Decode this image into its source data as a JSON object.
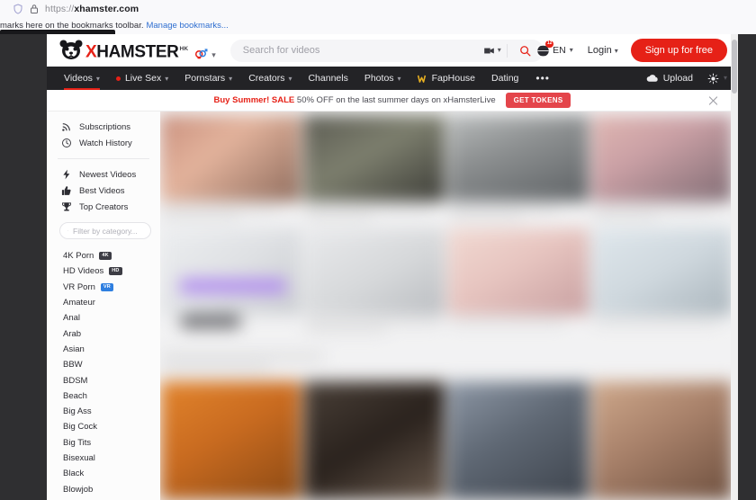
{
  "browser": {
    "url_prefix": "https://",
    "url_domain": "xhamster.com",
    "shield_icon": "shield-icon",
    "lock_icon": "lock-icon",
    "bookmark_text": "marks here on the bookmarks toolbar.",
    "bookmark_link": "Manage bookmarks..."
  },
  "site": {
    "logo": {
      "icon": "hamster-logo-icon",
      "x": "X",
      "rest": "HAMSTER",
      "superscript": "HK",
      "gender_icon": "gender-symbols-icon"
    },
    "search": {
      "placeholder": "Search for videos",
      "value": "",
      "camera_icon": "camera-filter-icon",
      "submit_icon": "search-icon"
    },
    "header_right": {
      "globe_icon": "globe-icon",
      "globe_badge": "12",
      "language": "EN",
      "login_label": "Login",
      "signup_label": "Sign up for free"
    },
    "nav": {
      "items": [
        {
          "label": "Videos",
          "caret": true,
          "active": true,
          "dot": false
        },
        {
          "label": "Live Sex",
          "caret": true,
          "active": false,
          "dot": true
        },
        {
          "label": "Pornstars",
          "caret": true,
          "active": false,
          "dot": false
        },
        {
          "label": "Creators",
          "caret": true,
          "active": false,
          "dot": false
        },
        {
          "label": "Channels",
          "caret": false,
          "active": false,
          "dot": false
        },
        {
          "label": "Photos",
          "caret": true,
          "active": false,
          "dot": false
        },
        {
          "label": "FapHouse",
          "caret": false,
          "active": false,
          "dot": false,
          "icon": "faphouse-w-icon"
        },
        {
          "label": "Dating",
          "caret": false,
          "active": false,
          "dot": false
        }
      ],
      "more_label": "•••",
      "upload_label": "Upload",
      "upload_icon": "cloud-upload-icon",
      "theme_icon": "brightness-sun-icon"
    },
    "promo": {
      "highlight": "Buy Summer! SALE",
      "text": " 50% OFF on the last summer days on xHamsterLive",
      "button": "GET TOKENS",
      "close_icon": "close-icon"
    },
    "sidebar": {
      "top_items": [
        {
          "label": "Subscriptions",
          "icon": "rss-icon"
        },
        {
          "label": "Watch History",
          "icon": "history-clock-icon"
        }
      ],
      "rank_items": [
        {
          "label": "Newest Videos",
          "icon": "lightning-bolt-icon"
        },
        {
          "label": "Best Videos",
          "icon": "thumbs-up-icon"
        },
        {
          "label": "Top Creators",
          "icon": "trophy-icon"
        }
      ],
      "filter": {
        "placeholder": "Filter by category...",
        "value": "",
        "icon": "search-icon"
      },
      "categories": [
        {
          "label": "4K Porn",
          "badge": "4K",
          "badge_style": "dark"
        },
        {
          "label": "HD Videos",
          "badge": "HD",
          "badge_style": "dark"
        },
        {
          "label": "VR Porn",
          "badge": "VR",
          "badge_style": "blue"
        },
        {
          "label": "Amateur",
          "badge": "",
          "badge_style": ""
        },
        {
          "label": "Anal",
          "badge": "",
          "badge_style": ""
        },
        {
          "label": "Arab",
          "badge": "",
          "badge_style": ""
        },
        {
          "label": "Asian",
          "badge": "",
          "badge_style": ""
        },
        {
          "label": "BBW",
          "badge": "",
          "badge_style": ""
        },
        {
          "label": "BDSM",
          "badge": "",
          "badge_style": ""
        },
        {
          "label": "Beach",
          "badge": "",
          "badge_style": ""
        },
        {
          "label": "Big Ass",
          "badge": "",
          "badge_style": ""
        },
        {
          "label": "Big Cock",
          "badge": "",
          "badge_style": ""
        },
        {
          "label": "Big Tits",
          "badge": "",
          "badge_style": ""
        },
        {
          "label": "Bisexual",
          "badge": "",
          "badge_style": ""
        },
        {
          "label": "Black",
          "badge": "",
          "badge_style": ""
        },
        {
          "label": "Blowjob",
          "badge": "",
          "badge_style": ""
        }
      ]
    }
  },
  "colors": {
    "brand_red": "#e62117",
    "nav_dark": "#232326",
    "promo_button": "#e4454b",
    "badge_blue": "#2f7fe0"
  }
}
